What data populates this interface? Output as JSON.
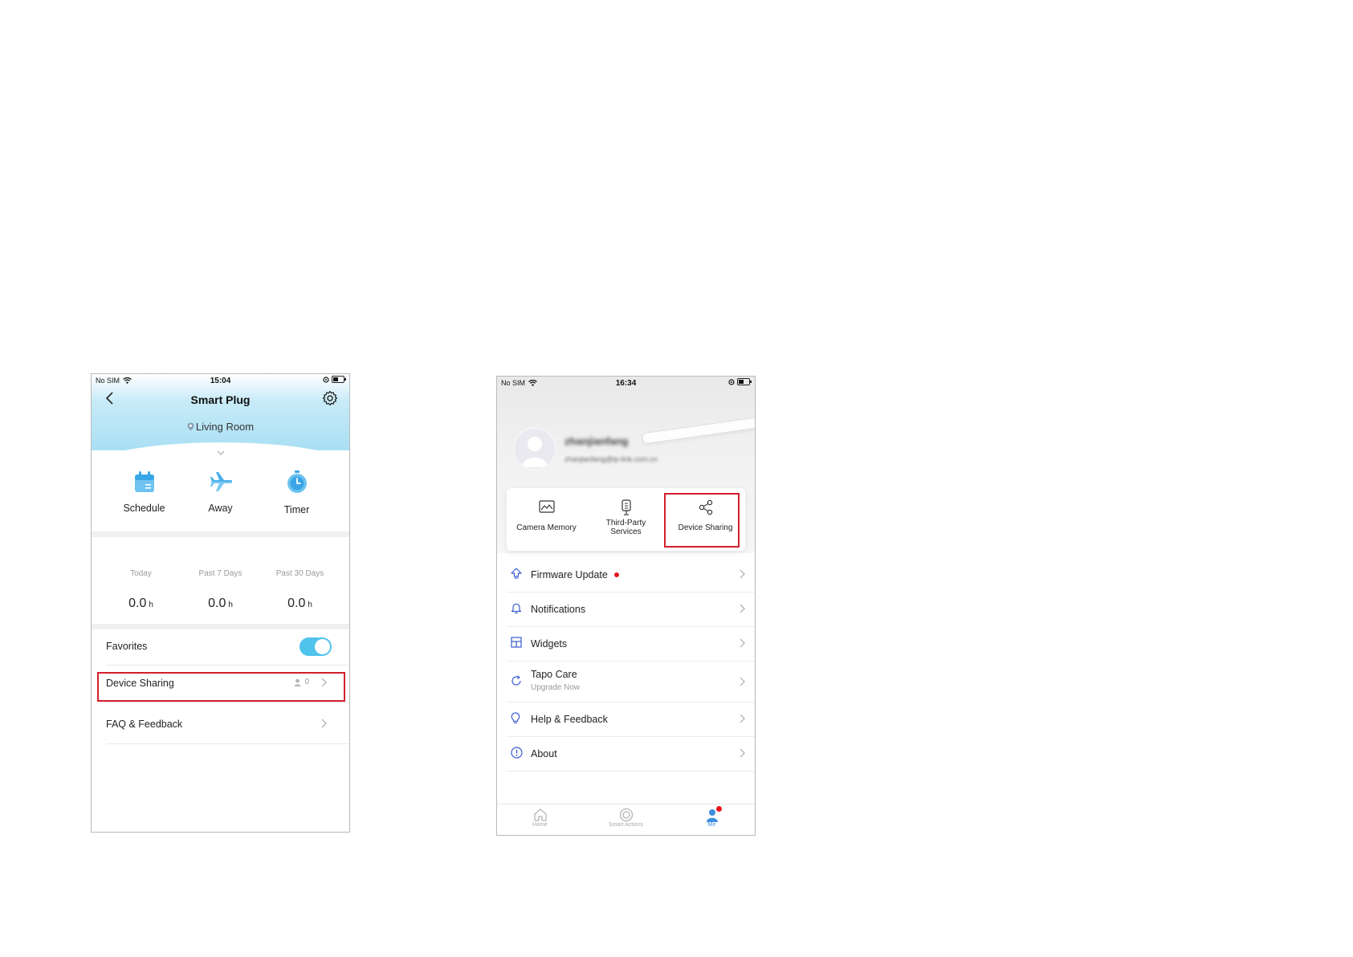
{
  "phone_left": {
    "status": {
      "carrier": "No SIM",
      "time": "15:04"
    },
    "title": "Smart Plug",
    "location": "Living Room",
    "modes": [
      {
        "label": "Schedule",
        "icon": "calendar-icon"
      },
      {
        "label": "Away",
        "icon": "airplane-icon"
      },
      {
        "label": "Timer",
        "icon": "timer-icon"
      }
    ],
    "stats": [
      {
        "label": "Today",
        "value": "0.0",
        "unit": "h"
      },
      {
        "label": "Past 7 Days",
        "value": "0.0",
        "unit": "h"
      },
      {
        "label": "Past 30 Days",
        "value": "0.0",
        "unit": "h"
      }
    ],
    "favorites": {
      "label": "Favorites",
      "enabled": true
    },
    "device_sharing": {
      "label": "Device Sharing",
      "count": "0"
    },
    "faq": {
      "label": "FAQ & Feedback"
    }
  },
  "phone_right": {
    "status": {
      "carrier": "No SIM",
      "time": "16:34"
    },
    "profile": {
      "name": "zhanjianfang",
      "email": "zhanjianfang@tp-link.com.cn"
    },
    "quick_items": [
      {
        "label": "Camera Memory",
        "icon": "image-icon"
      },
      {
        "label": "Third-Party Services",
        "label_line1": "Third-Party",
        "label_line2": "Services",
        "icon": "speaker-icon"
      },
      {
        "label": "Device Sharing",
        "icon": "share-icon"
      }
    ],
    "menu": [
      {
        "label": "Firmware Update",
        "icon": "upload-icon",
        "badge": true
      },
      {
        "label": "Notifications",
        "icon": "bell-icon"
      },
      {
        "label": "Widgets",
        "icon": "widgets-icon"
      },
      {
        "label": "Tapo Care",
        "sub": "Upgrade Now",
        "icon": "refresh-icon"
      },
      {
        "label": "Help & Feedback",
        "icon": "lightbulb-icon"
      },
      {
        "label": "About",
        "icon": "info-icon"
      }
    ],
    "tabs": [
      {
        "label": "Home",
        "icon": "home-icon"
      },
      {
        "label": "Smart Actions",
        "icon": "smart-actions-icon"
      },
      {
        "label": "Me",
        "icon": "person-icon",
        "active": true
      }
    ]
  },
  "colors": {
    "accent": "#4fc3ec",
    "highlight": "#d21f2d",
    "active_tab": "#3d8fe0",
    "badge": "#e5141f"
  }
}
